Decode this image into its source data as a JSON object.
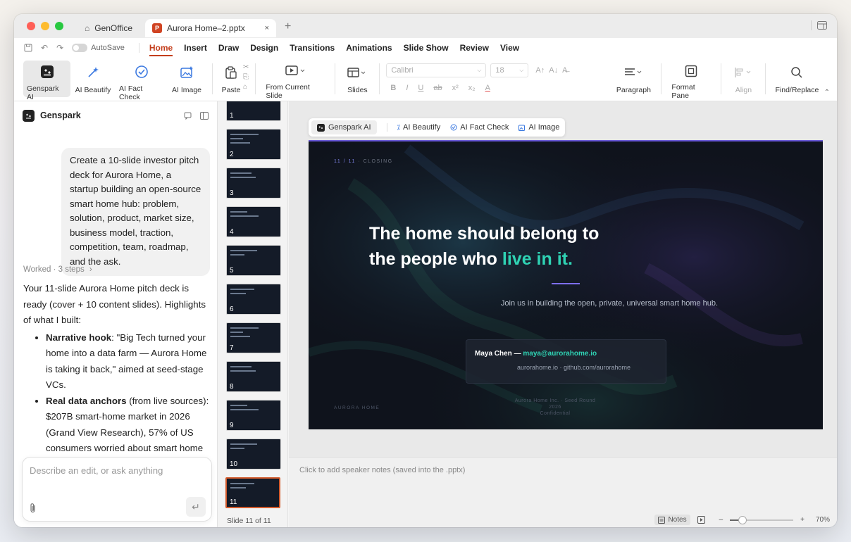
{
  "window": {
    "traffic_colors": [
      "#ff5f57",
      "#febc2e",
      "#28c840"
    ],
    "home_tab": "GenOffice",
    "active_tab": "Aurora Home–2.pptx",
    "ppt_badge": "P",
    "close": "×",
    "new_tab": "+"
  },
  "menubar": {
    "autosave": "AutoSave",
    "items": [
      "Home",
      "Insert",
      "Draw",
      "Design",
      "Transitions",
      "Animations",
      "Slide Show",
      "Review",
      "View"
    ],
    "active": "Home"
  },
  "ribbon": {
    "genspark_ai": "Genspark AI",
    "ai_beautify": "AI Beautify",
    "ai_fact_check": "AI Fact Check",
    "ai_image": "AI Image",
    "paste": "Paste",
    "from_current_slide": "From Current Slide",
    "slides": "Slides",
    "font_name": "Calibri",
    "font_size": "18",
    "paragraph": "Paragraph",
    "format_pane": "Format Pane",
    "align": "Align",
    "find_replace": "Find/Replace"
  },
  "chat": {
    "title": "Genspark",
    "user_message": "Create a 10-slide investor pitch deck for Aurora Home, a startup building an open-source smart home hub: problem, solution, product, market size, business model, traction, competition, team, roadmap, and the ask.",
    "worked": "Worked · 3 steps",
    "worked_arrow": "›",
    "response_intro": "Your 11-slide Aurora Home pitch deck is ready (cover + 10 content slides). Highlights of what I built:",
    "bullets": [
      {
        "bold": "Narrative hook",
        "text": ": \"Big Tech turned your home into a data farm — Aurora Home is taking it back,\" aimed at seed-stage VCs."
      },
      {
        "bold": "Real data anchors",
        "text": " (from live sources): $207B smart-home market in 2026 (Grand View Research), 57% of US consumers worried about smart home"
      }
    ],
    "input_placeholder": "Describe an edit, or ask anything",
    "send_glyph": "↵"
  },
  "thumbnails": {
    "numbers": [
      "1",
      "2",
      "3",
      "4",
      "5",
      "6",
      "7",
      "8",
      "9",
      "10",
      "11"
    ],
    "active": "11",
    "slide_counter": "Slide 11 of 11"
  },
  "ai_toolbar": {
    "genspark_ai": "Genspark AI",
    "ai_beautify": "AI Beautify",
    "ai_fact_check": "AI Fact Check",
    "ai_image": "AI Image"
  },
  "slide": {
    "kicker_num": "11 / 11",
    "kicker_label": " · CLOSING",
    "headline_line1": "The home should belong to",
    "headline_line2_pre": "the people who ",
    "headline_line2_accent": "live in it.",
    "subtitle": "Join us in building the open, private, universal smart home hub.",
    "contact_name": "Maya Chen — ",
    "contact_email": "maya@aurorahome.io",
    "contact_links": "aurorahome.io · github.com/aurorahome",
    "footer_left": "AURORA HOME",
    "footer_right_1": "Aurora Home Inc. · Seed Round 2026",
    "footer_right_2": "Confidential",
    "accent_color": "#2fd3b4"
  },
  "notes": {
    "placeholder": "Click to add speaker notes (saved into the .pptx)"
  },
  "status": {
    "notes": "Notes",
    "zoom_minus": "–",
    "zoom_plus": "+",
    "zoom": "70%"
  }
}
